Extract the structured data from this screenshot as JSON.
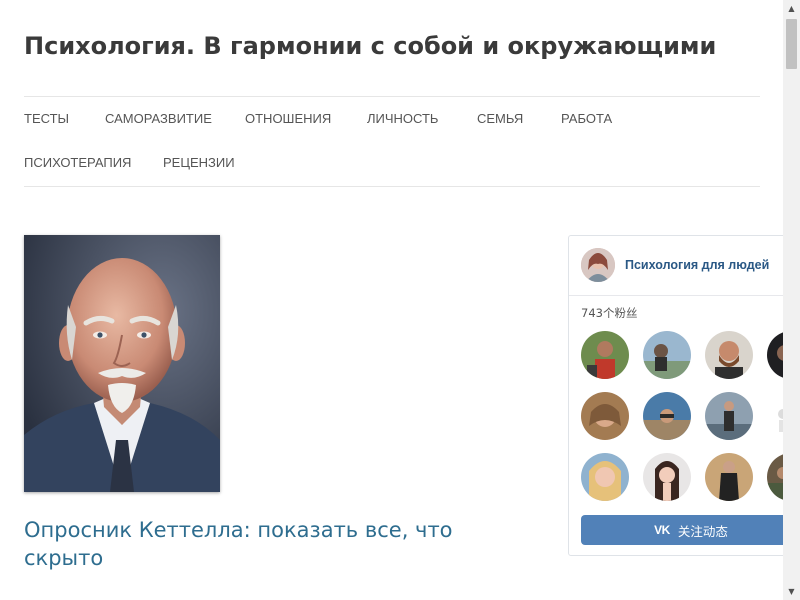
{
  "site": {
    "title": "Психология. В гармонии с собой и окружающими"
  },
  "nav": {
    "items": [
      {
        "label": "ТЕСТЫ"
      },
      {
        "label": "САМОРАЗВИТИЕ"
      },
      {
        "label": "ОТНОШЕНИЯ"
      },
      {
        "label": "ЛИЧНОСТЬ"
      },
      {
        "label": "СЕМЬЯ"
      },
      {
        "label": "РАБОТА"
      },
      {
        "label": "ПСИХОТЕРАПИЯ"
      },
      {
        "label": "РЕЦЕНЗИИ"
      }
    ]
  },
  "post": {
    "title": "Опросник Кеттелла: показать все, что скрыто"
  },
  "vk_widget": {
    "group_name": "Психология для людей",
    "followers": "743个粉丝",
    "follow_button": "关注动态",
    "logo_text": "VK",
    "brand_color": "#5181b8"
  },
  "colors": {
    "link": "#2e6d8f",
    "title": "#3a3a3a"
  }
}
